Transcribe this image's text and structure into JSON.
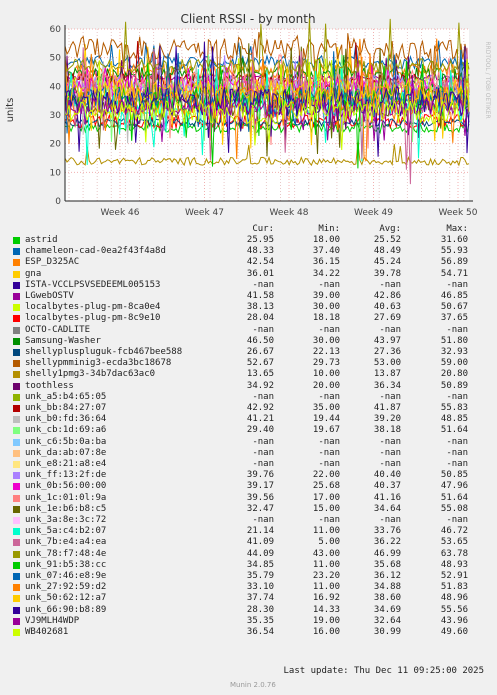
{
  "chart_data": {
    "type": "line",
    "title": "Client RSSI - by month",
    "ylabel": "units",
    "xlabel": "",
    "ylim": [
      0,
      60
    ],
    "yticks": [
      0,
      10,
      20,
      30,
      40,
      50,
      60
    ],
    "xticks": [
      "Week 46",
      "Week 47",
      "Week 48",
      "Week 49",
      "Week 50"
    ],
    "side_label": "RRDTOOL / TOBI OETIKER",
    "grid": true,
    "legend_headers": [
      "Cur:",
      "Min:",
      "Avg:",
      "Max:"
    ],
    "series": [
      {
        "name": "astrid",
        "color": "#00cc00",
        "cur": "25.95",
        "min": "18.00",
        "avg": "25.52",
        "max": "31.60"
      },
      {
        "name": "chameleon-cad-0ea2f43f4a8d",
        "color": "#0066b3",
        "cur": "48.33",
        "min": "37.40",
        "avg": "48.49",
        "max": "55.93"
      },
      {
        "name": "ESP_D325AC",
        "color": "#ff8000",
        "cur": "42.54",
        "min": "36.15",
        "avg": "45.24",
        "max": "56.89"
      },
      {
        "name": "gna",
        "color": "#ffcc00",
        "cur": "36.01",
        "min": "34.22",
        "avg": "39.78",
        "max": "54.71"
      },
      {
        "name": "ISTA-VCCLPSVSEDEEML005153",
        "color": "#330099",
        "cur": "-nan",
        "min": "-nan",
        "avg": "-nan",
        "max": "-nan"
      },
      {
        "name": "LGwebOSTV",
        "color": "#990099",
        "cur": "41.58",
        "min": "39.00",
        "avg": "42.86",
        "max": "46.85"
      },
      {
        "name": "localbytes-plug-pm-8ca0e4",
        "color": "#ccff00",
        "cur": "38.13",
        "min": "30.00",
        "avg": "40.63",
        "max": "50.67"
      },
      {
        "name": "localbytes-plug-pm-8c9e10",
        "color": "#ff0000",
        "cur": "28.04",
        "min": "18.18",
        "avg": "27.69",
        "max": "37.65"
      },
      {
        "name": "OCTO-CADLITE",
        "color": "#808080",
        "cur": "-nan",
        "min": "-nan",
        "avg": "-nan",
        "max": "-nan"
      },
      {
        "name": "Samsung-Washer",
        "color": "#008f00",
        "cur": "46.50",
        "min": "30.00",
        "avg": "43.97",
        "max": "51.80"
      },
      {
        "name": "shellypluspluguk-fcb467bee588",
        "color": "#00487d",
        "cur": "26.67",
        "min": "22.13",
        "avg": "27.36",
        "max": "32.93"
      },
      {
        "name": "shellypmminig3-ecda3bc18678",
        "color": "#b35a00",
        "cur": "52.67",
        "min": "29.73",
        "avg": "53.00",
        "max": "59.00"
      },
      {
        "name": "shelly1pmg3-34b7dac63ac0",
        "color": "#b38f00",
        "cur": "13.65",
        "min": "10.00",
        "avg": "13.87",
        "max": "20.80"
      },
      {
        "name": "toothless",
        "color": "#6b006b",
        "cur": "34.92",
        "min": "20.00",
        "avg": "36.34",
        "max": "50.89"
      },
      {
        "name": "unk_a5:b4:65:05",
        "color": "#8fb300",
        "cur": "-nan",
        "min": "-nan",
        "avg": "-nan",
        "max": "-nan"
      },
      {
        "name": "unk_bb:84:27:07",
        "color": "#b30000",
        "cur": "42.92",
        "min": "35.00",
        "avg": "41.87",
        "max": "55.83"
      },
      {
        "name": "unk_b0:fd:36:64",
        "color": "#bebebe",
        "cur": "41.21",
        "min": "19.44",
        "avg": "39.20",
        "max": "48.85"
      },
      {
        "name": "unk_cb:1d:69:a6",
        "color": "#80ff80",
        "cur": "29.40",
        "min": "19.67",
        "avg": "38.18",
        "max": "51.64"
      },
      {
        "name": "unk_c6:5b:0a:ba",
        "color": "#80c9ff",
        "cur": "-nan",
        "min": "-nan",
        "avg": "-nan",
        "max": "-nan"
      },
      {
        "name": "unk_da:ab:07:8e",
        "color": "#ffc080",
        "cur": "-nan",
        "min": "-nan",
        "avg": "-nan",
        "max": "-nan"
      },
      {
        "name": "unk_e8:21:a8:e4",
        "color": "#ffe680",
        "cur": "-nan",
        "min": "-nan",
        "avg": "-nan",
        "max": "-nan"
      },
      {
        "name": "unk_ff:13:2f:de",
        "color": "#aa80ff",
        "cur": "39.76",
        "min": "22.00",
        "avg": "40.40",
        "max": "50.85"
      },
      {
        "name": "unk_0b:56:00:00",
        "color": "#ee00cc",
        "cur": "39.17",
        "min": "25.68",
        "avg": "40.37",
        "max": "47.96"
      },
      {
        "name": "unk_1c:01:0l:9a",
        "color": "#ff8080",
        "cur": "39.56",
        "min": "17.00",
        "avg": "41.16",
        "max": "51.64"
      },
      {
        "name": "unk_1e:b6:b8:c5",
        "color": "#666600",
        "cur": "32.47",
        "min": "15.00",
        "avg": "34.64",
        "max": "55.08"
      },
      {
        "name": "unk_3a:8e:3c:72",
        "color": "#ffbfff",
        "cur": "-nan",
        "min": "-nan",
        "avg": "-nan",
        "max": "-nan"
      },
      {
        "name": "unk_5a:c4:b2:07",
        "color": "#00ffcc",
        "cur": "21.14",
        "min": "11.00",
        "avg": "33.76",
        "max": "46.72"
      },
      {
        "name": "unk_7b:e4:a4:ea",
        "color": "#cc6699",
        "cur": "41.09",
        "min": "5.00",
        "avg": "36.22",
        "max": "53.65"
      },
      {
        "name": "unk_78:f7:48:4e",
        "color": "#999900",
        "cur": "44.09",
        "min": "43.00",
        "avg": "46.99",
        "max": "63.78"
      },
      {
        "name": "unk_91:b5:38:cc",
        "color": "#00cc00",
        "cur": "34.85",
        "min": "11.00",
        "avg": "35.68",
        "max": "48.93"
      },
      {
        "name": "unk_07:46:e8:9e",
        "color": "#0066b3",
        "cur": "35.79",
        "min": "23.20",
        "avg": "36.12",
        "max": "52.91"
      },
      {
        "name": "unk_27:92:59:d2",
        "color": "#ff8000",
        "cur": "33.10",
        "min": "11.00",
        "avg": "34.88",
        "max": "51.83"
      },
      {
        "name": "unk_50:62:12:a7",
        "color": "#ffcc00",
        "cur": "37.74",
        "min": "16.92",
        "avg": "38.60",
        "max": "48.96"
      },
      {
        "name": "unk_66:90:b8:89",
        "color": "#330099",
        "cur": "28.30",
        "min": "14.33",
        "avg": "34.69",
        "max": "55.56"
      },
      {
        "name": "VJ9MLH4WDP",
        "color": "#990099",
        "cur": "35.35",
        "min": "19.00",
        "avg": "32.64",
        "max": "43.96"
      },
      {
        "name": "WB402681",
        "color": "#ccff00",
        "cur": "36.54",
        "min": "16.00",
        "avg": "30.99",
        "max": "49.60"
      }
    ],
    "last_update": "Last update: Thu Dec 11 09:25:00 2025",
    "credit": "Munin 2.0.76"
  }
}
